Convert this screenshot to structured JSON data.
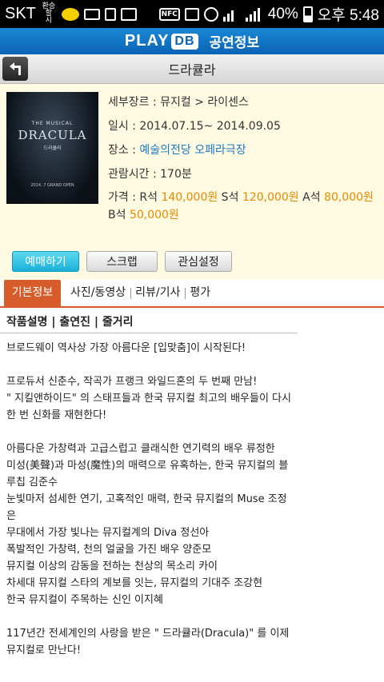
{
  "status_bar": {
    "carrier": "SKT",
    "network_note": "환승할\n시",
    "battery_percent": "40%",
    "time": "오후 5:48",
    "icons": [
      "talk-icon",
      "mail-icon",
      "download-icon",
      "image-icon",
      "nfc-icon",
      "mute-icon",
      "alarm-icon",
      "wifi-icon",
      "signal-icon",
      "battery-icon"
    ]
  },
  "header": {
    "logo_play": "PLAY",
    "logo_db": "DB",
    "title": "공연정보"
  },
  "titlebar": {
    "back_icon": "back-arrow-icon",
    "title": "드라큘라"
  },
  "poster": {
    "line1": "THE MUSICAL",
    "title": "DRACULA",
    "subtitle": "드라큘라",
    "footer": "2014. 7 GRAND OPEN"
  },
  "info": {
    "genre": "세부장르 : 뮤지컬 > 라이센스",
    "date": "일시 : 2014.07.15~ 2014.09.05",
    "venue_label": "장소 : ",
    "venue_link": "예술의전당 오페라극장",
    "runtime": "관람시간 : 170분",
    "price_label": "가격 : ",
    "prices": [
      {
        "seat": "R석 ",
        "amount": "140,000원"
      },
      {
        "seat": " S석 ",
        "amount": "120,000원"
      },
      {
        "seat": " A석 ",
        "amount": "80,000원"
      },
      {
        "seat": " B석 ",
        "amount": "50,000원"
      }
    ]
  },
  "buttons": {
    "reserve": "예매하기",
    "scrap": "스크랩",
    "interest": "관심설정"
  },
  "tabs": [
    "기본정보",
    "사진/동영상",
    "리뷰/기사",
    "평가"
  ],
  "subnav": "작품설명 | 출연진 | 줄거리",
  "description": [
    "브로드웨이 역사상 가장 아름다운 [입맞춤]이 시작된다!",
    "",
    "프로듀서 신춘수, 작곡가 프랭크 와일드혼의 두 번째 만남!",
    "\" 지킬앤하이드\" 의 스태프들과 한국 뮤지컬 최고의 배우들이 다시 한 번 신화를 재현한다!",
    "",
    "아름다운 가창력과 고급스럽고 클래식한 연기력의 배우 류정한",
    "미성(美聲)과 마성(魔性)의 매력으로 유혹하는, 한국 뮤지컬의 블루칩 김준수",
    "눈빛마저 섬세한 연기, 고혹적인 매력, 한국 뮤지컬의 Muse 조정은",
    "무대에서 가장 빛나는 뮤지컬계의 Diva 정선아",
    "폭발적인 가창력, 천의 얼굴을 가진 배우 양준모",
    "뮤지컬 이상의 감동을 전하는 천상의 목소리 카이",
    "차세대 뮤지컬 스타의 계보를 잇는, 뮤지컬의 기대주 조강현",
    "한국 뮤지컬이 주목하는 신인 이지혜",
    "",
    "117년간 전세계인의 사랑을 받은 \" 드라큘라(Dracula)\" 를 이제 뮤지컬로 만난다!"
  ]
}
